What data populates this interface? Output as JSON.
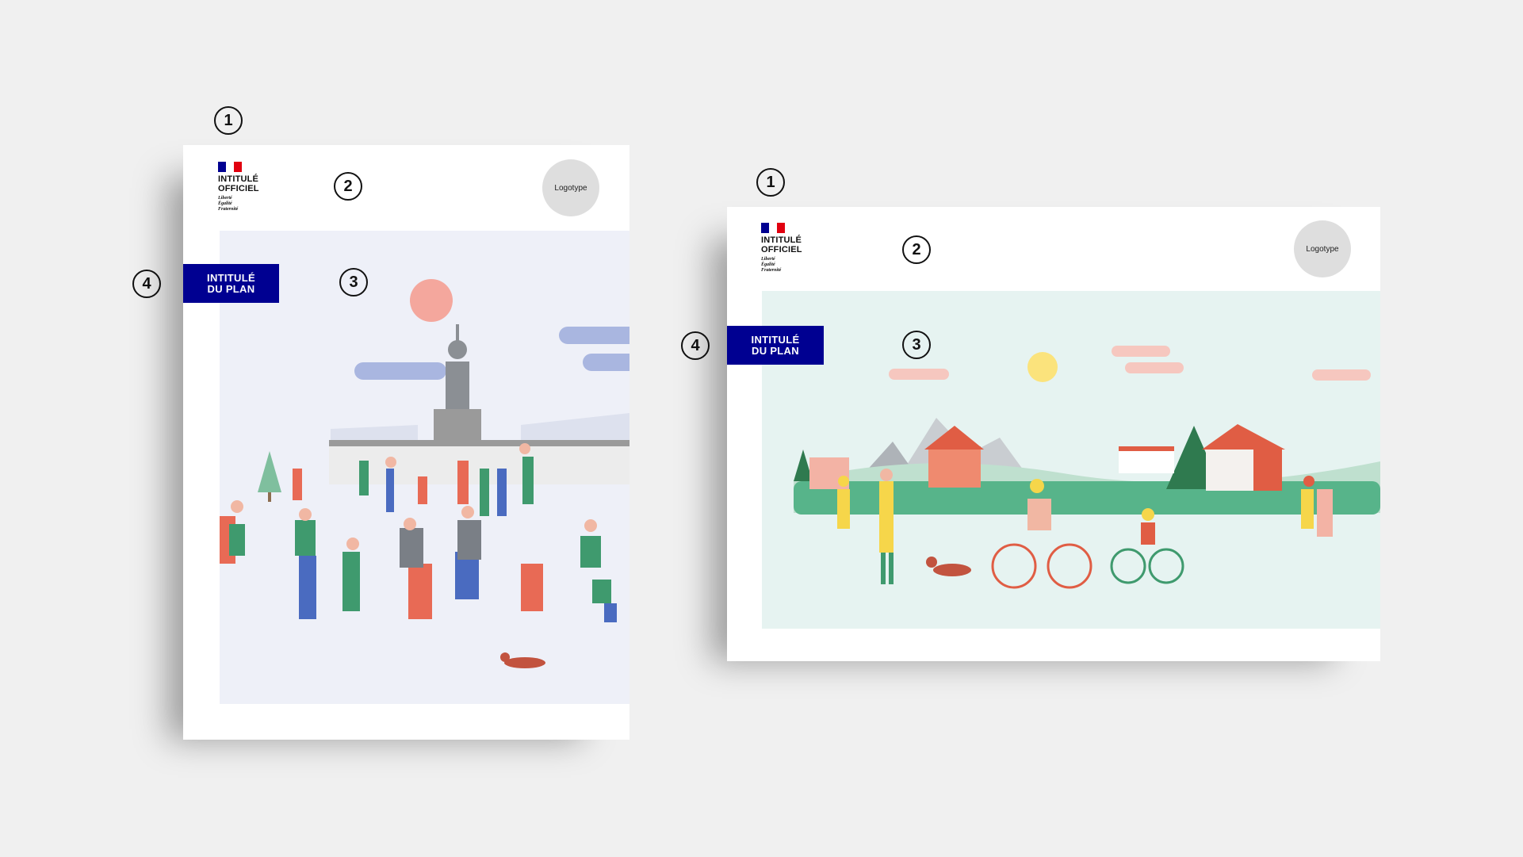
{
  "markers": {
    "one": "1",
    "two": "2",
    "three": "3",
    "four": "4"
  },
  "official_logo": {
    "line1": "INTITULÉ",
    "line2": "OFFICIEL",
    "motto1": "Liberté",
    "motto2": "Égalité",
    "motto3": "Fraternité"
  },
  "logotype_label": "Logotype",
  "plan_title": {
    "line1": "INTITULÉ",
    "line2": "DU PLAN"
  },
  "colors": {
    "flag_blue": "#000091",
    "flag_white": "#ffffff",
    "flag_red": "#e1000f",
    "plan_box": "#000091",
    "left_bg": "#eef0f8",
    "right_bg": "#e6f3f1"
  },
  "illustrations": {
    "left": "city square crowd illustration",
    "right": "countryside family outing illustration"
  }
}
